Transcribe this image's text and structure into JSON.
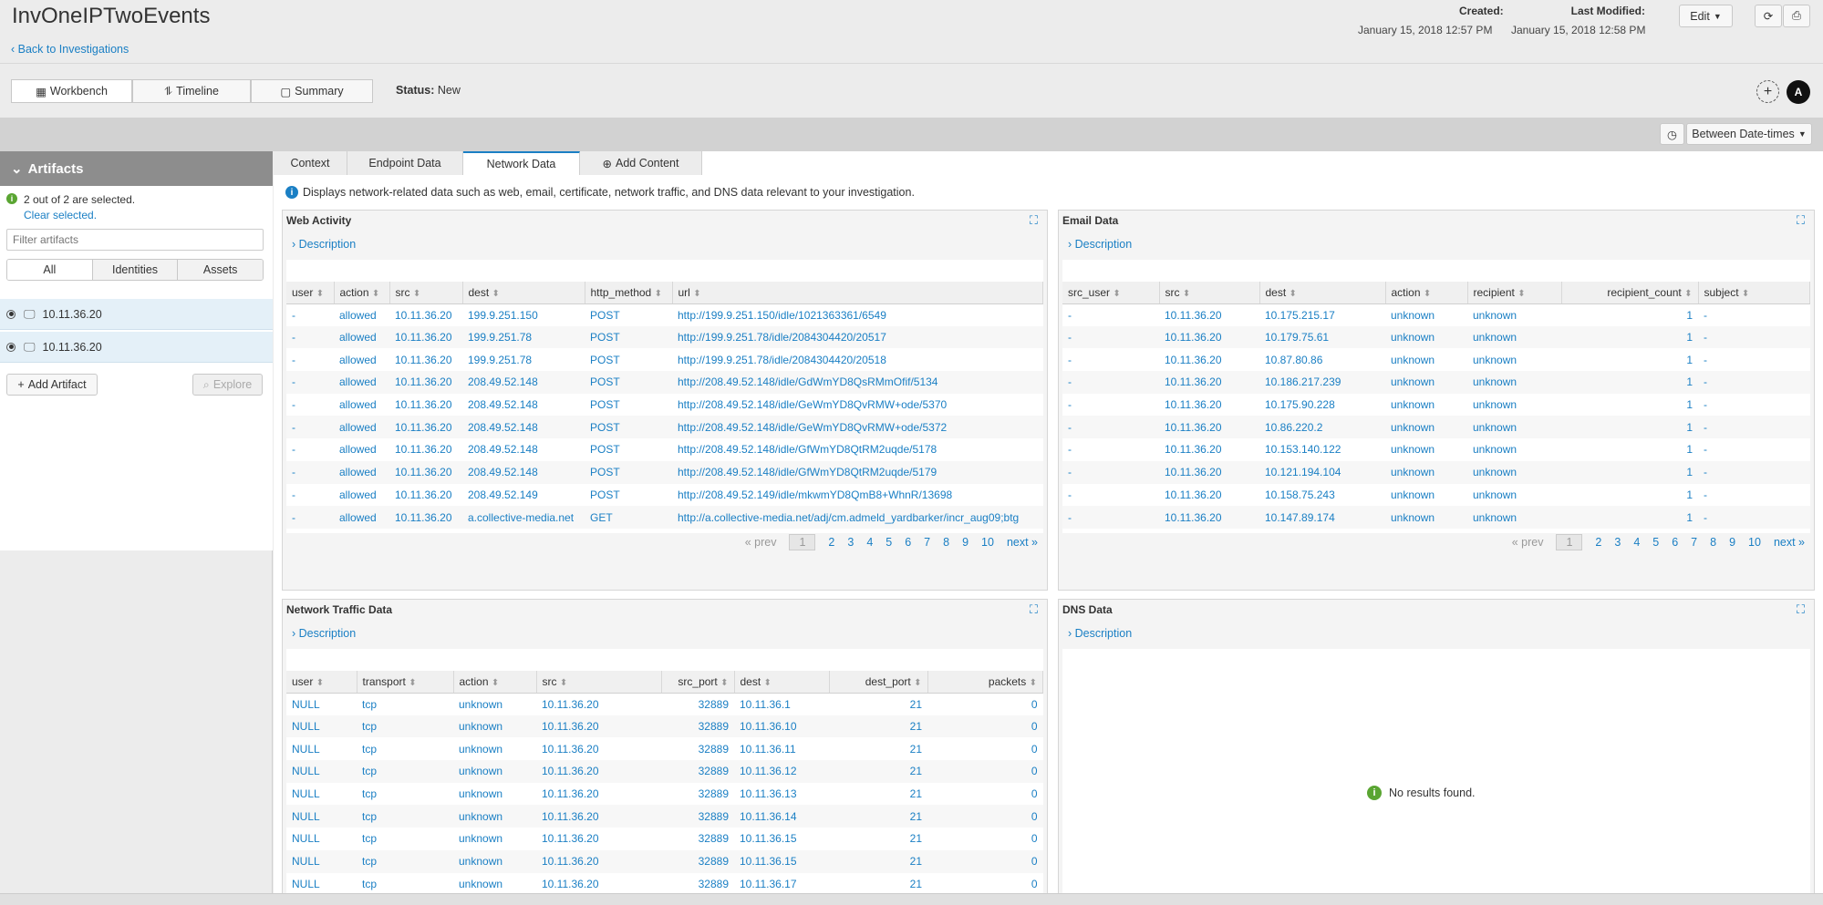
{
  "header": {
    "title": "InvOneIPTwoEvents",
    "back_link": "Back to Investigations",
    "created_label": "Created:",
    "created_value": "January 15, 2018 12:57 PM",
    "modified_label": "Last Modified:",
    "modified_value": "January 15, 2018 12:58 PM",
    "edit_label": "Edit"
  },
  "views": {
    "workbench": "Workbench",
    "timeline": "Timeline",
    "summary": "Summary"
  },
  "status": {
    "label": "Status:",
    "value": "New"
  },
  "avatar": "A",
  "time_filter": "Between Date-times",
  "artifacts": {
    "title": "Artifacts",
    "selected_text": "2 out of 2 are selected.",
    "clear_text": "Clear selected.",
    "filter_placeholder": "Filter artifacts",
    "filters": [
      "All",
      "Identities",
      "Assets"
    ],
    "items": [
      "10.11.36.20",
      "10.11.36.20"
    ],
    "add_label": "Add Artifact",
    "explore_label": "Explore"
  },
  "tabs": {
    "context": "Context",
    "endpoint": "Endpoint Data",
    "network": "Network Data",
    "add": "Add Content"
  },
  "info_text": "Displays network-related data such as web, email, certificate, network traffic, and DNS data relevant to your investigation.",
  "description_label": "Description",
  "pager": {
    "prev": "« prev",
    "next": "next »",
    "pages": [
      "1",
      "2",
      "3",
      "4",
      "5",
      "6",
      "7",
      "8",
      "9",
      "10"
    ]
  },
  "web": {
    "title": "Web Activity",
    "columns": [
      "user",
      "action",
      "src",
      "dest",
      "http_method",
      "url"
    ],
    "rows": [
      [
        "-",
        "allowed",
        "10.11.36.20",
        "199.9.251.150",
        "POST",
        "http://199.9.251.150/idle/1021363361/6549"
      ],
      [
        "-",
        "allowed",
        "10.11.36.20",
        "199.9.251.78",
        "POST",
        "http://199.9.251.78/idle/2084304420/20517"
      ],
      [
        "-",
        "allowed",
        "10.11.36.20",
        "199.9.251.78",
        "POST",
        "http://199.9.251.78/idle/2084304420/20518"
      ],
      [
        "-",
        "allowed",
        "10.11.36.20",
        "208.49.52.148",
        "POST",
        "http://208.49.52.148/idle/GdWmYD8QsRMmOfif/5134"
      ],
      [
        "-",
        "allowed",
        "10.11.36.20",
        "208.49.52.148",
        "POST",
        "http://208.49.52.148/idle/GeWmYD8QvRMW+ode/5370"
      ],
      [
        "-",
        "allowed",
        "10.11.36.20",
        "208.49.52.148",
        "POST",
        "http://208.49.52.148/idle/GeWmYD8QvRMW+ode/5372"
      ],
      [
        "-",
        "allowed",
        "10.11.36.20",
        "208.49.52.148",
        "POST",
        "http://208.49.52.148/idle/GfWmYD8QtRM2uqde/5178"
      ],
      [
        "-",
        "allowed",
        "10.11.36.20",
        "208.49.52.148",
        "POST",
        "http://208.49.52.148/idle/GfWmYD8QtRM2uqde/5179"
      ],
      [
        "-",
        "allowed",
        "10.11.36.20",
        "208.49.52.149",
        "POST",
        "http://208.49.52.149/idle/mkwmYD8QmB8+WhnR/13698"
      ],
      [
        "-",
        "allowed",
        "10.11.36.20",
        "a.collective-media.net",
        "GET",
        "http://a.collective-media.net/adj/cm.admeld_yardbarker/incr_aug09;btg"
      ]
    ]
  },
  "email": {
    "title": "Email Data",
    "columns": [
      "src_user",
      "src",
      "dest",
      "action",
      "recipient",
      "recipient_count",
      "subject"
    ],
    "rows": [
      [
        "-",
        "10.11.36.20",
        "10.175.215.17",
        "unknown",
        "unknown",
        "1",
        "-"
      ],
      [
        "-",
        "10.11.36.20",
        "10.179.75.61",
        "unknown",
        "unknown",
        "1",
        "-"
      ],
      [
        "-",
        "10.11.36.20",
        "10.87.80.86",
        "unknown",
        "unknown",
        "1",
        "-"
      ],
      [
        "-",
        "10.11.36.20",
        "10.186.217.239",
        "unknown",
        "unknown",
        "1",
        "-"
      ],
      [
        "-",
        "10.11.36.20",
        "10.175.90.228",
        "unknown",
        "unknown",
        "1",
        "-"
      ],
      [
        "-",
        "10.11.36.20",
        "10.86.220.2",
        "unknown",
        "unknown",
        "1",
        "-"
      ],
      [
        "-",
        "10.11.36.20",
        "10.153.140.122",
        "unknown",
        "unknown",
        "1",
        "-"
      ],
      [
        "-",
        "10.11.36.20",
        "10.121.194.104",
        "unknown",
        "unknown",
        "1",
        "-"
      ],
      [
        "-",
        "10.11.36.20",
        "10.158.75.243",
        "unknown",
        "unknown",
        "1",
        "-"
      ],
      [
        "-",
        "10.11.36.20",
        "10.147.89.174",
        "unknown",
        "unknown",
        "1",
        "-"
      ]
    ]
  },
  "traffic": {
    "title": "Network Traffic Data",
    "columns": [
      "user",
      "transport",
      "action",
      "src",
      "src_port",
      "dest",
      "dest_port",
      "packets"
    ],
    "rows": [
      [
        "NULL",
        "tcp",
        "unknown",
        "10.11.36.20",
        "32889",
        "10.11.36.1",
        "21",
        "0"
      ],
      [
        "NULL",
        "tcp",
        "unknown",
        "10.11.36.20",
        "32889",
        "10.11.36.10",
        "21",
        "0"
      ],
      [
        "NULL",
        "tcp",
        "unknown",
        "10.11.36.20",
        "32889",
        "10.11.36.11",
        "21",
        "0"
      ],
      [
        "NULL",
        "tcp",
        "unknown",
        "10.11.36.20",
        "32889",
        "10.11.36.12",
        "21",
        "0"
      ],
      [
        "NULL",
        "tcp",
        "unknown",
        "10.11.36.20",
        "32889",
        "10.11.36.13",
        "21",
        "0"
      ],
      [
        "NULL",
        "tcp",
        "unknown",
        "10.11.36.20",
        "32889",
        "10.11.36.14",
        "21",
        "0"
      ],
      [
        "NULL",
        "tcp",
        "unknown",
        "10.11.36.20",
        "32889",
        "10.11.36.15",
        "21",
        "0"
      ],
      [
        "NULL",
        "tcp",
        "unknown",
        "10.11.36.20",
        "32889",
        "10.11.36.15",
        "21",
        "0"
      ],
      [
        "NULL",
        "tcp",
        "unknown",
        "10.11.36.20",
        "32889",
        "10.11.36.17",
        "21",
        "0"
      ]
    ]
  },
  "dns": {
    "title": "DNS Data",
    "empty_text": "No results found."
  }
}
